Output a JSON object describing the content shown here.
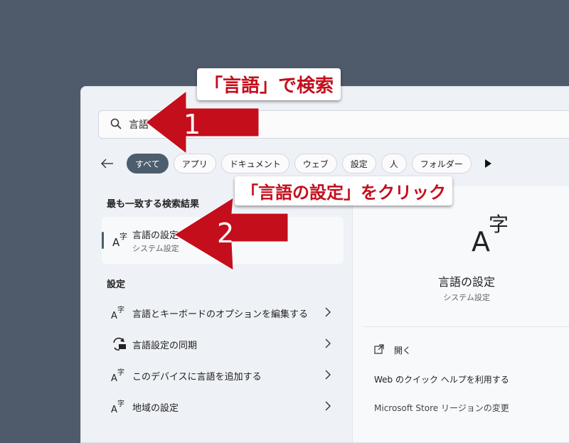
{
  "search": {
    "query": "言語"
  },
  "filters": {
    "back_icon": "back-arrow-icon",
    "chips": [
      "すべて",
      "アプリ",
      "ドキュメント",
      "ウェブ",
      "設定",
      "人",
      "フォルダー"
    ],
    "more_icon": "play-right-icon"
  },
  "best_match": {
    "heading": "最も一致する検索結果",
    "title": "言語の設定",
    "subtitle": "システム設定",
    "icon": "language-icon"
  },
  "settings": {
    "heading": "設定",
    "items": [
      {
        "label": "言語とキーボードのオプションを編集する",
        "icon": "language-icon"
      },
      {
        "label": "言語設定の同期",
        "icon": "sync-icon"
      },
      {
        "label": "このデバイスに言語を追加する",
        "icon": "language-icon"
      },
      {
        "label": "地域の設定",
        "icon": "language-icon"
      }
    ]
  },
  "detail": {
    "title": "言語の設定",
    "subtitle": "システム設定",
    "actions": [
      {
        "label": "開く",
        "icon": "open-external-icon"
      },
      {
        "label": "Web のクイック ヘルプを利用する"
      },
      {
        "label": "Microsoft Store リージョンの変更"
      }
    ]
  },
  "annotations": {
    "step1_number": "1",
    "step1_text": "「言語」で検索",
    "step2_number": "2",
    "step2_text": "「言語の設定」をクリック",
    "color": "#c40e1c"
  },
  "colors": {
    "accent": "#4c5e6e",
    "background": "#4f5b6a",
    "panel": "#eef1f6"
  }
}
